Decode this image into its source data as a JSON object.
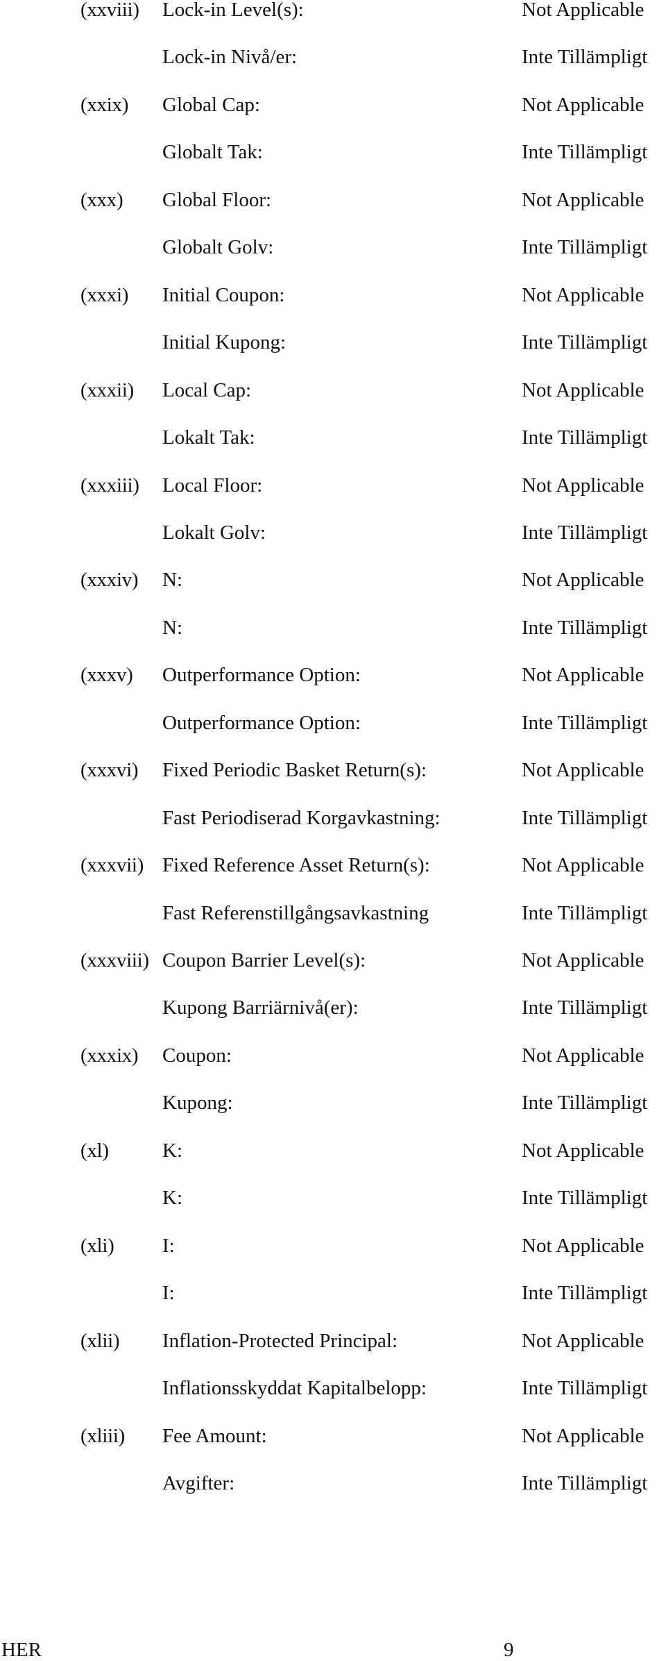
{
  "items": [
    {
      "num": "(xxviii)",
      "label_en": "Lock-in Level(s):",
      "value_en": "Not Applicable",
      "label_sv": "Lock-in Nivå/er:",
      "value_sv": "Inte Tillämpligt"
    },
    {
      "num": "(xxix)",
      "label_en": "Global Cap:",
      "value_en": "Not Applicable",
      "label_sv": "Globalt Tak:",
      "value_sv": "Inte Tillämpligt"
    },
    {
      "num": "(xxx)",
      "label_en": "Global Floor:",
      "value_en": "Not Applicable",
      "label_sv": "Globalt Golv:",
      "value_sv": "Inte Tillämpligt"
    },
    {
      "num": "(xxxi)",
      "label_en": "Initial Coupon:",
      "value_en": "Not Applicable",
      "label_sv": "Initial Kupong:",
      "value_sv": "Inte Tillämpligt"
    },
    {
      "num": "(xxxii)",
      "label_en": "Local Cap:",
      "value_en": "Not Applicable",
      "label_sv": "Lokalt Tak:",
      "value_sv": "Inte Tillämpligt"
    },
    {
      "num": "(xxxiii)",
      "label_en": "Local Floor:",
      "value_en": "Not Applicable",
      "label_sv": "Lokalt Golv:",
      "value_sv": "Inte Tillämpligt"
    },
    {
      "num": "(xxxiv)",
      "label_en": "N:",
      "value_en": "Not Applicable",
      "label_sv": "N:",
      "value_sv": "Inte Tillämpligt"
    },
    {
      "num": "(xxxv)",
      "label_en": "Outperformance Option:",
      "value_en": "Not Applicable",
      "label_sv": "Outperformance Option:",
      "value_sv": "Inte Tillämpligt"
    },
    {
      "num": "(xxxvi)",
      "label_en": "Fixed Periodic Basket Return(s):",
      "value_en": "Not Applicable",
      "label_sv": "Fast Periodiserad Korgavkastning:",
      "value_sv": "Inte Tillämpligt"
    },
    {
      "num": "(xxxvii)",
      "label_en": "Fixed Reference Asset Return(s):",
      "value_en": "Not Applicable",
      "label_sv": "Fast Referenstillgångsavkastning",
      "value_sv": "Inte Tillämpligt"
    },
    {
      "num": "(xxxviii)",
      "label_en": "Coupon Barrier Level(s):",
      "value_en": "Not Applicable",
      "label_sv": "Kupong Barriärnivå(er):",
      "value_sv": "Inte Tillämpligt"
    },
    {
      "num": "(xxxix)",
      "label_en": "Coupon:",
      "value_en": "Not Applicable",
      "label_sv": "Kupong:",
      "value_sv": "Inte Tillämpligt"
    },
    {
      "num": "(xl)",
      "label_en": "K:",
      "value_en": "Not Applicable",
      "label_sv": "K:",
      "value_sv": "Inte Tillämpligt"
    },
    {
      "num": "(xli)",
      "label_en": "I:",
      "value_en": "Not Applicable",
      "label_sv": "I:",
      "value_sv": "Inte Tillämpligt"
    },
    {
      "num": "(xlii)",
      "label_en": "Inflation-Protected Principal:",
      "value_en": "Not Applicable",
      "label_sv": "Inflationsskyddat Kapitalbelopp:",
      "value_sv": "Inte Tillämpligt"
    },
    {
      "num": "(xliii)",
      "label_en": "Fee Amount:",
      "value_en": "Not Applicable",
      "label_sv": "Avgifter:",
      "value_sv": "Inte Tillämpligt"
    }
  ],
  "footer": {
    "left": "HER",
    "page_number": "9"
  }
}
